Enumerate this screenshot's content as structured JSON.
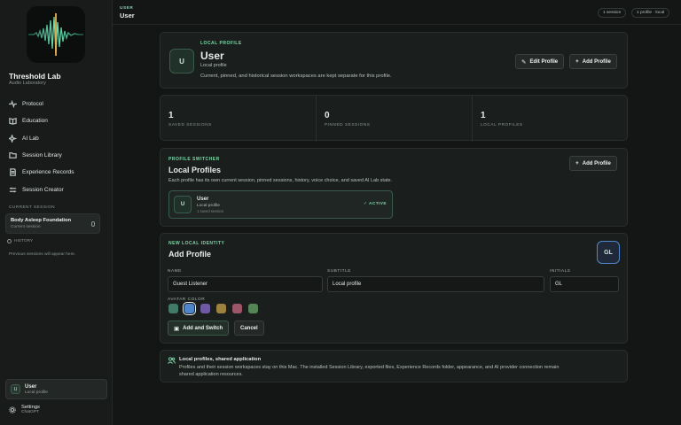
{
  "app": {
    "title": "Threshold Lab",
    "subtitle": "Audio Laboratory"
  },
  "nav": [
    {
      "label": "Protocol",
      "icon": "pulse-icon"
    },
    {
      "label": "Education",
      "icon": "book-icon"
    },
    {
      "label": "AI Lab",
      "icon": "sparkle-icon"
    },
    {
      "label": "Session Library",
      "icon": "folder-icon"
    },
    {
      "label": "Experience Records",
      "icon": "document-icon"
    },
    {
      "label": "Session Creator",
      "icon": "sliders-icon"
    }
  ],
  "current_session": {
    "section_label": "CURRENT SESSION",
    "title": "Body Asleep Foundation",
    "subtitle": "Current session"
  },
  "history": {
    "label": "HISTORY",
    "empty_text": "Previous sessions will appear here."
  },
  "user_card": {
    "initial": "U",
    "name": "User",
    "subtitle": "Local profile"
  },
  "settings": {
    "label": "Settings",
    "subtitle": "ChatGPT"
  },
  "topbar": {
    "eyebrow": "USER",
    "title": "User",
    "sessions_pill": "1 session",
    "profile_pill": "1 profile · local"
  },
  "profile": {
    "eyebrow": "LOCAL PROFILE",
    "initial": "U",
    "name": "User",
    "kind": "Local profile",
    "description": "Current, pinned, and historical session workspaces are kept separate for this profile.",
    "edit_label": "Edit Profile",
    "add_label": "Add Profile"
  },
  "stats": [
    {
      "value": "1",
      "label": "SAVED SESSIONS"
    },
    {
      "value": "0",
      "label": "PINNED SESSIONS"
    },
    {
      "value": "1",
      "label": "LOCAL PROFILES"
    }
  ],
  "switcher": {
    "eyebrow": "PROFILE SWITCHER",
    "title": "Local Profiles",
    "description": "Each profile has its own current session, pinned sessions, history, voice choice, and saved AI Lab state.",
    "add_label": "Add Profile",
    "card": {
      "initial": "U",
      "name": "User",
      "kind": "Local profile",
      "meta": "1 saved session",
      "status": "ACTIVE"
    }
  },
  "new_profile": {
    "eyebrow": "NEW LOCAL IDENTITY",
    "title": "Add Profile",
    "preview_initials": "GL",
    "name_label": "NAME",
    "name_value": "Guest Listener",
    "subtitle_label": "SUBTITLE",
    "subtitle_value": "Local profile",
    "initials_label": "INITIALS",
    "initials_value": "GL",
    "color_label": "AVATAR COLOR",
    "colors": [
      "#4f9a80",
      "#4f86c9",
      "#8a6fcf",
      "#c9a34a",
      "#c96a82",
      "#6aa86a"
    ],
    "selected_color_index": 1,
    "submit_label": "Add and Switch",
    "cancel_label": "Cancel"
  },
  "info": {
    "title": "Local profiles, shared application",
    "text": "Profiles and their session workspaces stay on this Mac. The installed Session Library, exported files, Experience Records folder, appearance, and AI provider connection remain shared application resources."
  }
}
